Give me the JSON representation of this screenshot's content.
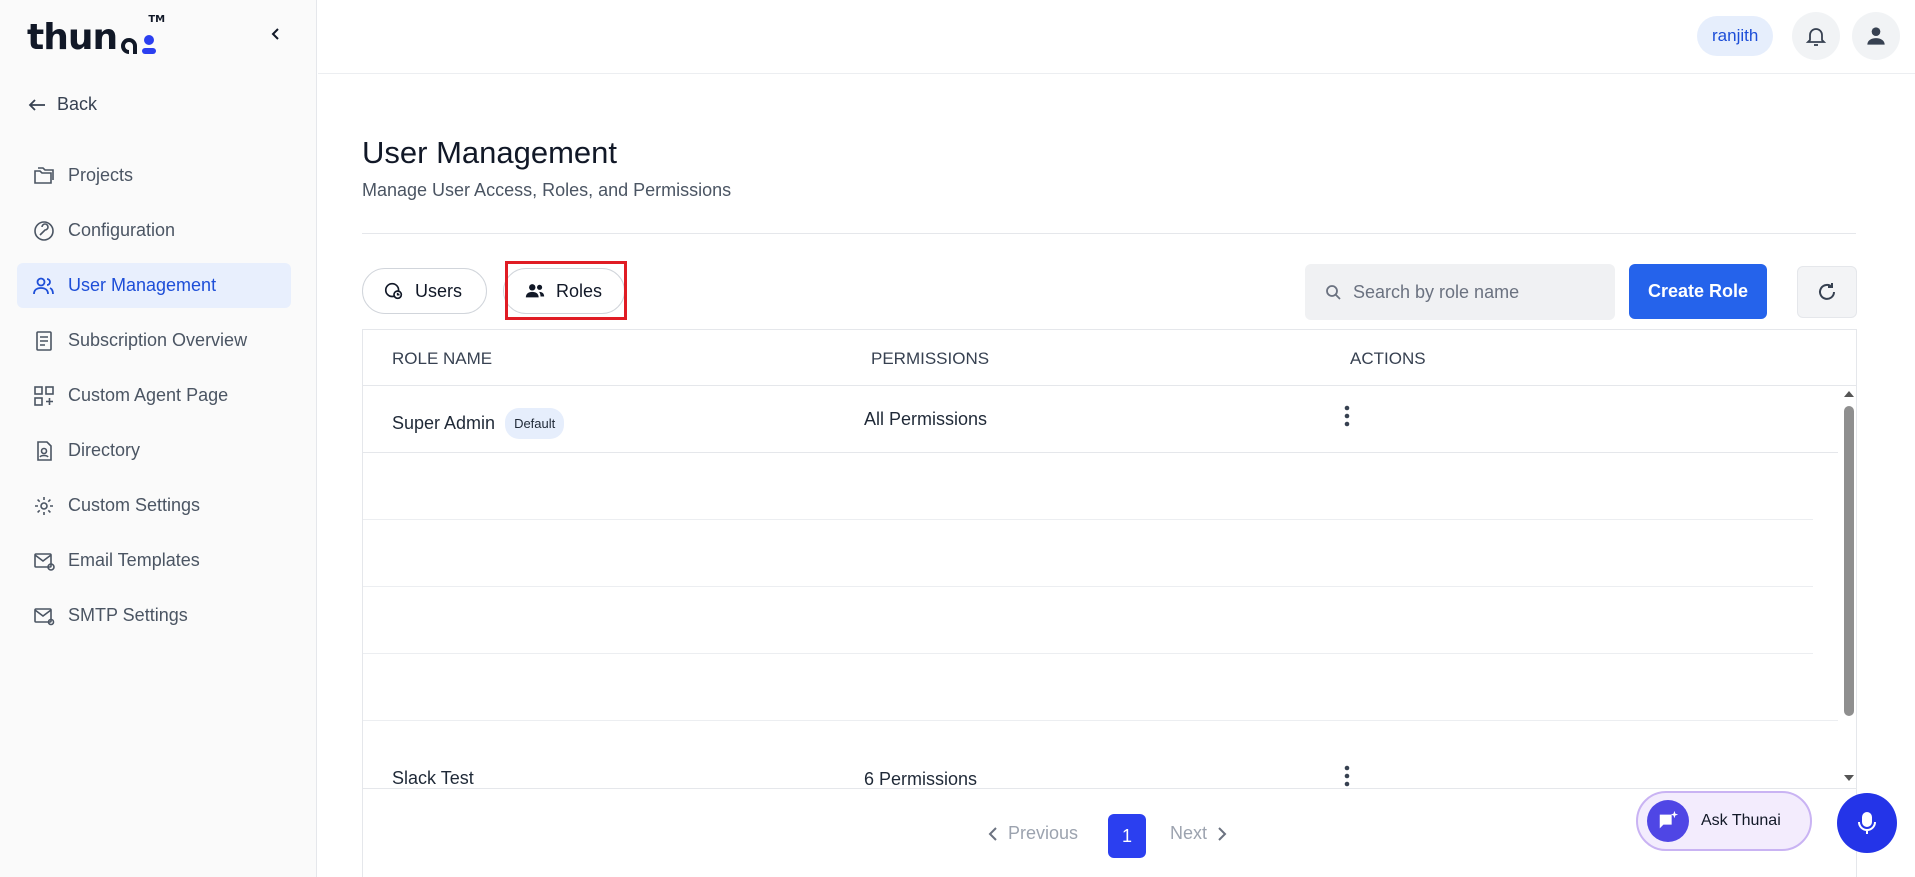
{
  "brand": {
    "logo_text": "thun",
    "trademark": "TM"
  },
  "sidebar": {
    "back_label": "Back",
    "items": [
      {
        "label": "Projects",
        "icon": "folders-icon"
      },
      {
        "label": "Configuration",
        "icon": "configuration-icon"
      },
      {
        "label": "User Management",
        "icon": "users-icon",
        "active": true
      },
      {
        "label": "Subscription Overview",
        "icon": "receipt-icon"
      },
      {
        "label": "Custom Agent Page",
        "icon": "grid-plus-icon"
      },
      {
        "label": "Directory",
        "icon": "contact-file-icon"
      },
      {
        "label": "Custom Settings",
        "icon": "settings-gear-icon"
      },
      {
        "label": "Email Templates",
        "icon": "mail-template-icon"
      },
      {
        "label": "SMTP Settings",
        "icon": "mail-settings-icon"
      }
    ]
  },
  "header": {
    "username": "ranjith"
  },
  "main": {
    "title": "User Management",
    "subtitle": "Manage User Access, Roles, and Permissions",
    "tabs": [
      {
        "label": "Users"
      },
      {
        "label": "Roles",
        "selected": true
      }
    ],
    "search": {
      "placeholder": "Search by role name",
      "value": ""
    },
    "create_button": "Create Role"
  },
  "table": {
    "columns": [
      "ROLE NAME",
      "PERMISSIONS",
      "ACTIONS"
    ],
    "rows": [
      {
        "role": "Super Admin",
        "badge": "Default",
        "permissions": "All Permissions"
      },
      {
        "role": "Slack Test",
        "badge": "",
        "permissions": "6 Permissions"
      }
    ]
  },
  "pagination": {
    "previous": "Previous",
    "current_page": "1",
    "next": "Next"
  },
  "assistant": {
    "ask_label": "Ask Thunai"
  },
  "colors": {
    "primary": "#2563eb",
    "active_nav_bg": "#e8effd",
    "highlight": "#e01c24",
    "assistant_bg": "#f3ecfd"
  }
}
